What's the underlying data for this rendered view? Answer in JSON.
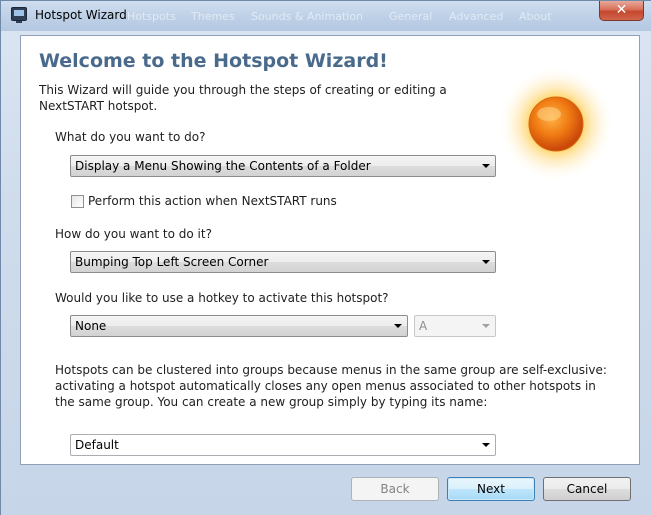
{
  "window": {
    "title": "Hotspot Wizard",
    "close_label": "✕",
    "ghost_tabs": [
      "Hotspots",
      "Themes",
      "Sounds & Animation",
      "General",
      "Advanced",
      "About"
    ]
  },
  "wizard": {
    "heading": "Welcome to the Hotspot Wizard!",
    "intro": "This Wizard will guide you through the steps of creating or editing a NextSTART hotspot."
  },
  "form": {
    "action_label": "What do you want to do?",
    "action_value": "Display a Menu Showing the Contents of a Folder",
    "run_checkbox_label": "Perform this action when NextSTART runs",
    "run_checkbox_checked": false,
    "method_label": "How do you want to do it?",
    "method_value": "Bumping Top Left Screen Corner",
    "hotkey_label": "Would you like to use a hotkey to activate this hotspot?",
    "hotkey_value": "None",
    "hotkey_key_value": "A",
    "groups_text": "Hotspots can be clustered into groups because menus in the same group are self-exclusive: activating a hotspot automatically closes any open menus associated to other hotspots in the same group. You can create a new group simply by typing its name:",
    "group_value": "Default"
  },
  "buttons": {
    "back": "Back",
    "next": "Next",
    "cancel": "Cancel"
  },
  "colors": {
    "heading": "#4a6a8c",
    "default_button_border": "#3c7fb1",
    "sun_core": "#e8660c",
    "sun_glow": "#ffb400"
  },
  "icons": {
    "app": "monitor-icon",
    "sun": "sun-icon",
    "dropdown": "chevron-down-icon"
  }
}
